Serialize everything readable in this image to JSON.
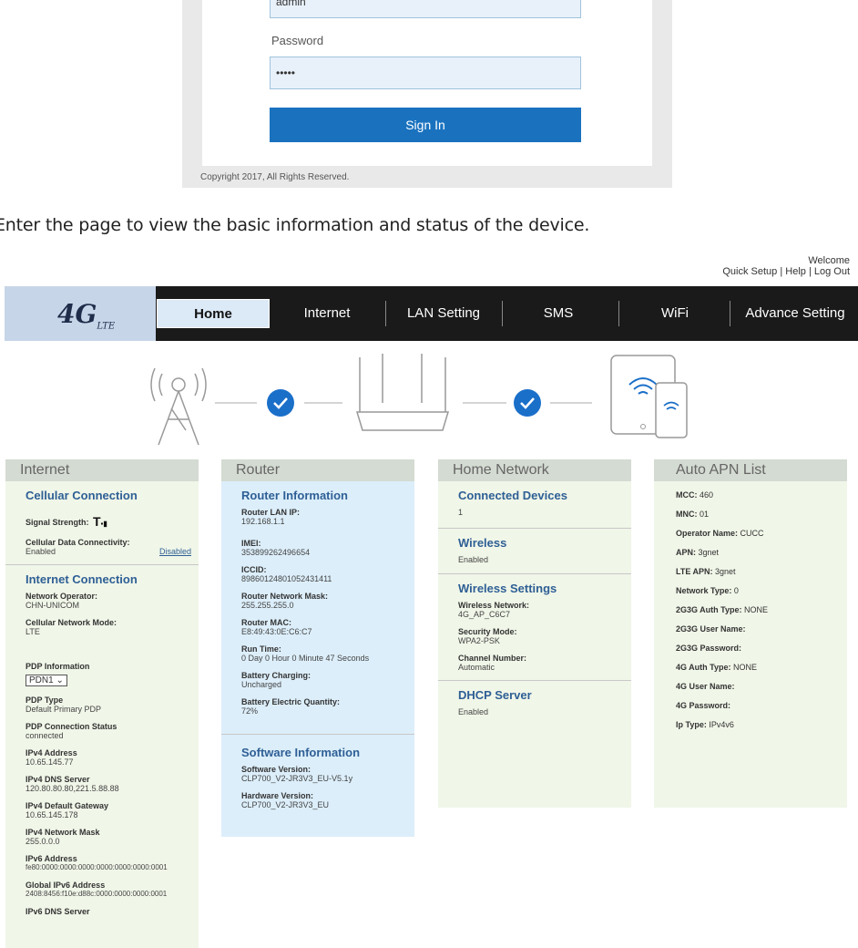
{
  "login": {
    "username_value": "admin",
    "password_label": "Password",
    "password_value": "•••••",
    "signin_label": "Sign In",
    "copyright": "Copyright 2017, All Rights Reserved."
  },
  "caption": "Enter the page to view the basic information and status of the device.",
  "top": {
    "welcome": "Welcome",
    "links": "Quick Setup | Help | Log Out"
  },
  "logo": {
    "main": "4G",
    "sub": "LTE"
  },
  "nav": [
    "Home",
    "Internet",
    "LAN Setting",
    "SMS",
    "WiFi",
    "Advance Setting"
  ],
  "internet": {
    "title": "Internet",
    "cellular_head": "Cellular Connection",
    "signal_label": "Signal Strength:",
    "data_conn_label": "Cellular Data Connectivity:",
    "data_conn_value": "Enabled",
    "data_conn_link": "Disabled",
    "internet_head": "Internet Connection",
    "fields": [
      {
        "label": "Network Operator:",
        "value": "CHN-UNICOM"
      },
      {
        "label": "Cellular Network Mode:",
        "value": "LTE"
      }
    ],
    "pdp_label": "PDP Information",
    "pdp_select": "PDN1",
    "fields2": [
      {
        "label": "PDP Type",
        "value": "Default Primary PDP"
      },
      {
        "label": "PDP Connection Status",
        "value": "connected"
      },
      {
        "label": "IPv4 Address",
        "value": "10.65.145.77"
      },
      {
        "label": "IPv4 DNS Server",
        "value": "120.80.80.80,221.5.88.88"
      },
      {
        "label": "IPv4 Default Gateway",
        "value": "10.65.145.178"
      },
      {
        "label": "IPv4 Network Mask",
        "value": "255.0.0.0"
      },
      {
        "label": "IPv6 Address",
        "value": "fe80:0000:0000:0000:0000:0000:0000:0001"
      },
      {
        "label": "Global IPv6 Address",
        "value": "2408:8456:f10e:d88c:0000:0000:0000:0001"
      },
      {
        "label": "IPv6 DNS Server",
        "value": ""
      }
    ]
  },
  "router": {
    "title": "Router",
    "info_head": "Router Information",
    "fields": [
      {
        "label": "Router LAN IP:",
        "value": "192.168.1.1"
      },
      {
        "label": "IMEI:",
        "value": "353899262496654"
      },
      {
        "label": "ICCID:",
        "value": "89860124801052431411"
      },
      {
        "label": "Router Network Mask:",
        "value": "255.255.255.0"
      },
      {
        "label": "Router MAC:",
        "value": "E8:49:43:0E:C6:C7"
      },
      {
        "label": "Run Time:",
        "value": "0 Day 0 Hour 0 Minute 47 Seconds"
      },
      {
        "label": "Battery Charging:",
        "value": "Uncharged"
      },
      {
        "label": "Battery Electric Quantity:",
        "value": "72%"
      }
    ],
    "software_head": "Software Information",
    "software_fields": [
      {
        "label": "Software Version:",
        "value": "CLP700_V2-JR3V3_EU-V5.1y"
      },
      {
        "label": "Hardware Version:",
        "value": "CLP700_V2-JR3V3_EU"
      }
    ]
  },
  "home_network": {
    "title": "Home Network",
    "devices_head": "Connected Devices",
    "devices_count": "1",
    "wireless_head": "Wireless",
    "wireless_value": "Enabled",
    "settings_head": "Wireless Settings",
    "settings_fields": [
      {
        "label": "Wireless Network:",
        "value": "4G_AP_C6C7"
      },
      {
        "label": "Security Mode:",
        "value": "WPA2-PSK"
      },
      {
        "label": "Channel Number:",
        "value": "Automatic"
      }
    ],
    "dhcp_head": "DHCP Server",
    "dhcp_value": "Enabled"
  },
  "apn": {
    "title": "Auto APN List",
    "rows": [
      {
        "label": "MCC:",
        "value": "460"
      },
      {
        "label": "MNC:",
        "value": "01"
      },
      {
        "label": "Operator Name:",
        "value": "CUCC"
      },
      {
        "label": "APN:",
        "value": "3gnet"
      },
      {
        "label": "LTE APN:",
        "value": "3gnet"
      },
      {
        "label": "Network Type:",
        "value": "0"
      },
      {
        "label": "2G3G Auth Type:",
        "value": "NONE"
      },
      {
        "label": "2G3G User Name:",
        "value": ""
      },
      {
        "label": "2G3G Password:",
        "value": ""
      },
      {
        "label": "4G Auth Type:",
        "value": "NONE"
      },
      {
        "label": "4G User Name:",
        "value": ""
      },
      {
        "label": "4G Password:",
        "value": ""
      },
      {
        "label": "Ip Type:",
        "value": "IPv4v6"
      }
    ]
  },
  "colors": {
    "accent": "#1a72bf",
    "nav_bg": "#1a1a1a",
    "section_head": "#2e5f95",
    "check": "#1a6fc9"
  }
}
